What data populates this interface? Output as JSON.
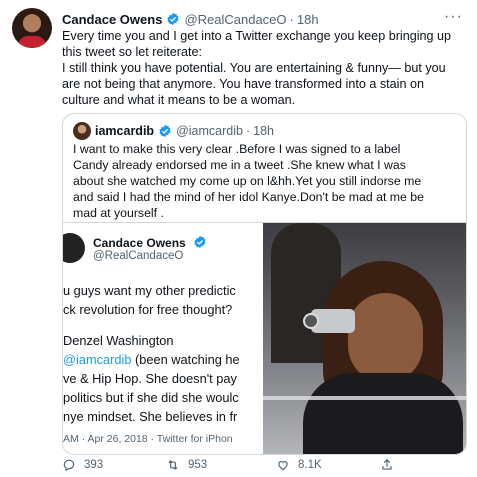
{
  "tweet": {
    "name": "Candace Owens",
    "handle": "@RealCandaceO",
    "time": "18h",
    "dot": "·",
    "more": "···",
    "text": [
      "Every time you and I get into a Twitter exchange you keep bringing up",
      "this tweet so let reiterate:",
      "I still think you have potential. You are entertaining & funny— but you",
      "are not being that anymore. You have transformed into a stain on",
      "culture and what it means to be a woman."
    ]
  },
  "quote": {
    "name": "iamcardib",
    "handle": "@iamcardib",
    "time": "18h",
    "dot": "·",
    "text": [
      "I want to make this very clear .Before I was signed to a label",
      "Candy already endorsed me in a tweet .She knew what I was",
      "about she watched my come up on l&hh.Yet you still indorse me",
      "and said I had the mind of her idol Kanye.Don't be mad at me be",
      "mad at yourself ."
    ]
  },
  "embed": {
    "name": "Candace Owens",
    "handle": "@RealCandaceO",
    "line1": "u guys want my other predictic",
    "line2": "ck revolution for free thought?",
    "line3": "Denzel Washington",
    "mention": "@iamcardib",
    "line4_rest": " (been watching he",
    "line5": "ve & Hip Hop. She doesn't pay",
    "line6": "politics but if she did she woulc",
    "line7": "nye mindset. She believes in fr",
    "footer": "AM · Apr 26, 2018 · Twitter for iPhon"
  },
  "actions": {
    "reply_count": "393",
    "retweet_count": "953",
    "like_count": "8.1K"
  },
  "colors": {
    "verified": "#1d9bf0",
    "link": "#1d9bf0",
    "secondary_text": "#536471"
  },
  "icons": [
    "verified-icon",
    "more-icon",
    "reply-icon",
    "retweet-icon",
    "like-icon",
    "share-icon"
  ]
}
